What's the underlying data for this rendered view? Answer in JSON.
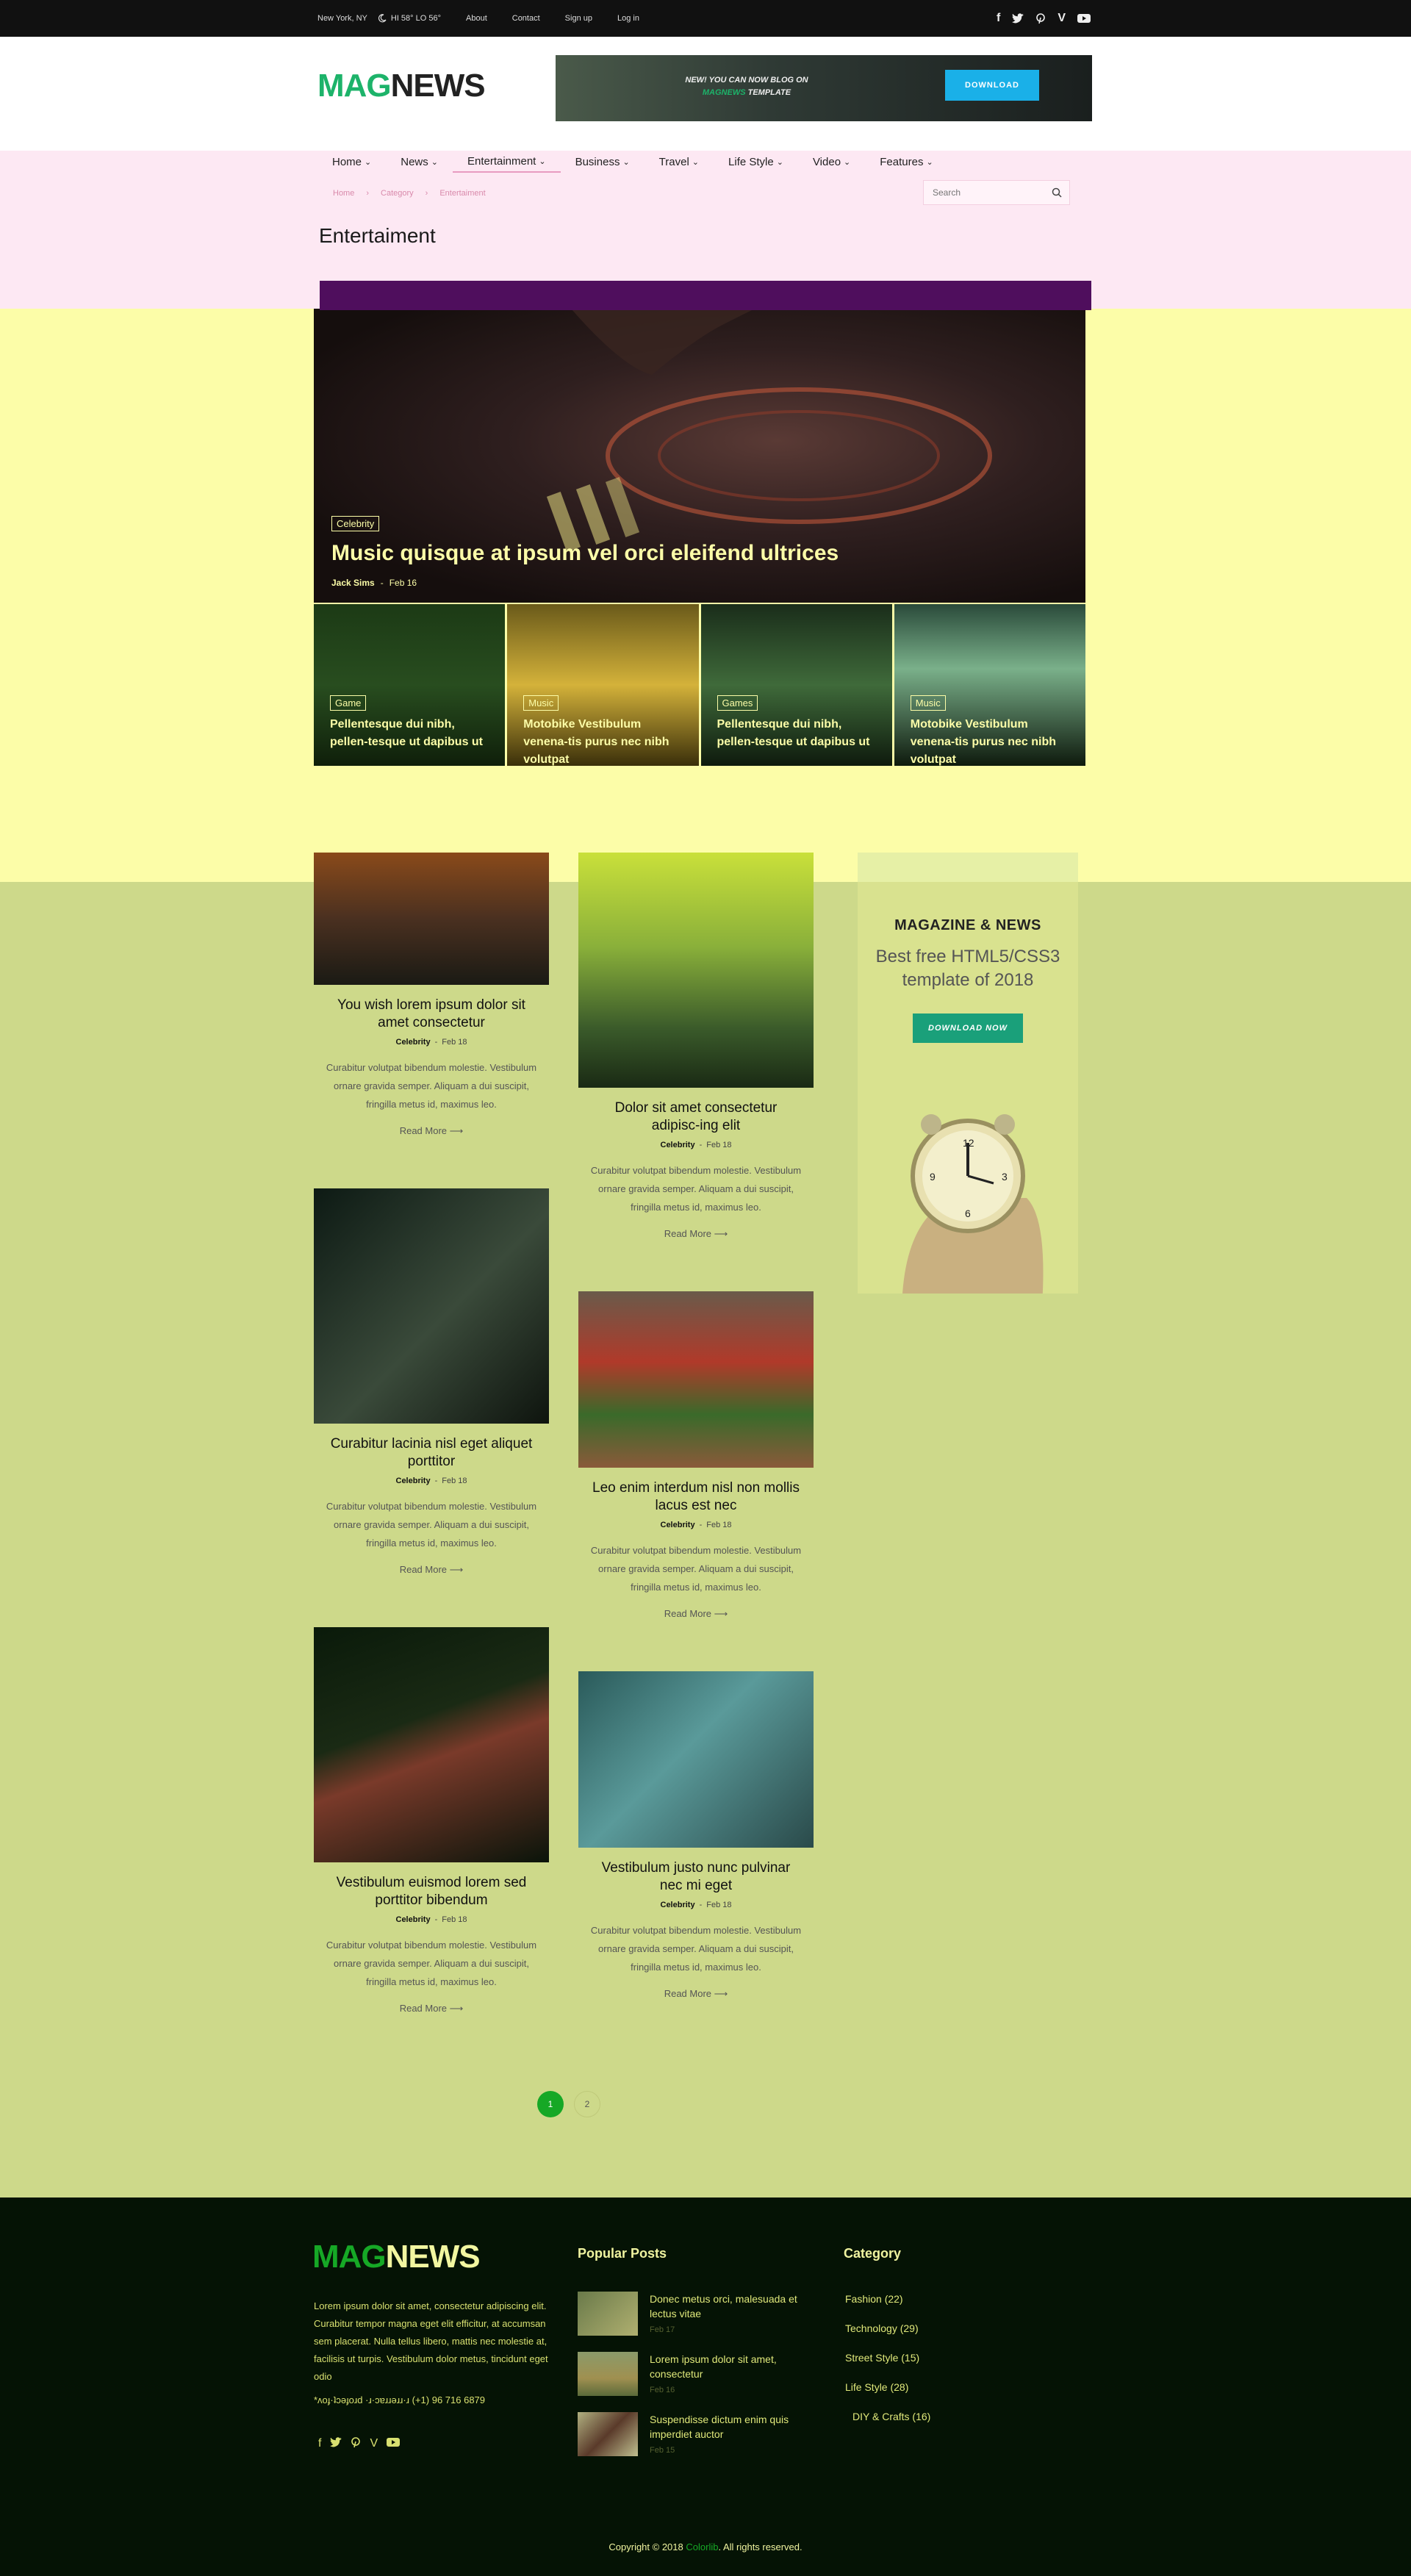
{
  "topbar": {
    "location": "New York, NY",
    "weather": "HI 58° LO 56°",
    "links": [
      "About",
      "Contact",
      "Sign up",
      "Log in"
    ],
    "socials": [
      "facebook-icon",
      "twitter-icon",
      "pinterest-icon",
      "vimeo-icon",
      "youtube-icon"
    ]
  },
  "header": {
    "logo_mag": "MAG",
    "logo_news": "NEWS",
    "banner_line1_strong": "NEW!",
    "banner_line1": "YOU CAN NOW BLOG ON",
    "banner_line2_brand": "MAGNEWS",
    "banner_line2": "TEMPLATE",
    "banner_button": "DOWNLOAD"
  },
  "nav": {
    "items": [
      {
        "label": "Home",
        "dropdown": true
      },
      {
        "label": "News",
        "dropdown": true
      },
      {
        "label": "Entertainment",
        "dropdown": true,
        "active": true
      },
      {
        "label": "Business",
        "dropdown": true
      },
      {
        "label": "Travel",
        "dropdown": true
      },
      {
        "label": "Life Style",
        "dropdown": true
      },
      {
        "label": "Video",
        "dropdown": true
      },
      {
        "label": "Features",
        "dropdown": true
      }
    ]
  },
  "breadcrumb": [
    "Home",
    "Category",
    "Entertaiment"
  ],
  "search": {
    "placeholder": "Search"
  },
  "page_title": "Entertaiment",
  "hero": {
    "tag": "Celebrity",
    "title": "Music quisque at ipsum vel orci eleifend ultrices",
    "author": "Jack Sims",
    "date": "Feb 16"
  },
  "thumbs": [
    {
      "tag": "Game",
      "title": "Pellentesque dui nibh, pellen-tesque ut dapibus ut"
    },
    {
      "tag": "Music",
      "title": "Motobike Vestibulum venena-tis purus nec nibh volutpat"
    },
    {
      "tag": "Games",
      "title": "Pellentesque dui nibh, pellen-tesque ut dapibus ut"
    },
    {
      "tag": "Music",
      "title": "Motobike Vestibulum venena-tis purus nec nibh volutpat"
    }
  ],
  "articles": [
    {
      "title": "You wish lorem ipsum dolor sit amet consectetur",
      "category": "Celebrity",
      "date": "Feb 18",
      "excerpt": "Curabitur volutpat bibendum molestie. Vestibulum ornare gravida semper. Aliquam a dui suscipit, fringilla metus id, maximus leo.",
      "more": "Read More"
    },
    {
      "title": "Dolor sit amet consectetur adipisc-ing elit",
      "category": "Celebrity",
      "date": "Feb 18",
      "excerpt": "Curabitur volutpat bibendum molestie. Vestibulum ornare gravida semper. Aliquam a dui suscipit, fringilla metus id, maximus leo.",
      "more": "Read More"
    },
    {
      "title": "Curabitur lacinia nisl eget aliquet porttitor",
      "category": "Celebrity",
      "date": "Feb 18",
      "excerpt": "Curabitur volutpat bibendum molestie. Vestibulum ornare gravida semper. Aliquam a dui suscipit, fringilla metus id, maximus leo.",
      "more": "Read More"
    },
    {
      "title": "Leo enim interdum nisl non mollis lacus est nec",
      "category": "Celebrity",
      "date": "Feb 18",
      "excerpt": "Curabitur volutpat bibendum molestie. Vestibulum ornare gravida semper. Aliquam a dui suscipit, fringilla metus id, maximus leo.",
      "more": "Read More"
    },
    {
      "title": "Vestibulum euismod lorem sed porttitor bibendum",
      "category": "Celebrity",
      "date": "Feb 18",
      "excerpt": "Curabitur volutpat bibendum molestie. Vestibulum ornare gravida semper. Aliquam a dui suscipit, fringilla metus id, maximus leo.",
      "more": "Read More"
    },
    {
      "title": "Vestibulum justo nunc pulvinar nec mi eget",
      "category": "Celebrity",
      "date": "Feb 18",
      "excerpt": "Curabitur volutpat bibendum molestie. Vestibulum ornare gravida semper. Aliquam a dui suscipit, fringilla metus id, maximus leo.",
      "more": "Read More"
    }
  ],
  "ad": {
    "heading": "MAGAZINE & NEWS",
    "sub": "Best free HTML5/CSS3 template of 2018",
    "button": "DOWNLOAD NOW"
  },
  "pagination": [
    "1",
    "2"
  ],
  "footer": {
    "logo_mag": "MAG",
    "logo_news": "NEWS",
    "about": "Lorem ipsum dolor sit amet, consectetur adipiscing elit. Curabitur tempor magna eget elit efficitur, at accumsan sem placerat. Nulla tellus libero, mattis nec molestie at, facilisis ut turpis. Vestibulum dolor metus, tincidunt eget odio",
    "phone": "*ʌoɟ·ʇɔǝɟoɹd ·ɹ·ɔɐɹɹǝɹɹ·ɹ (+1) 96 716 6879",
    "popular_heading": "Popular Posts",
    "popular": [
      {
        "title": "Donec metus orci, malesuada et lectus vitae",
        "date": "Feb 17"
      },
      {
        "title": "Lorem ipsum dolor sit amet, consectetur",
        "date": "Feb 16"
      },
      {
        "title": "Suspendisse dictum enim quis imperdiet auctor",
        "date": "Feb 15"
      }
    ],
    "category_heading": "Category",
    "categories": [
      "Fashion (22)",
      "Technology (29)",
      "Street Style (15)",
      "Life Style (28)",
      "DIY & Crafts (16)"
    ],
    "copyright_pre": "Copyright © 2018",
    "copyright_brand": "Colorlib",
    "copyright_post": ". All rights reserved."
  },
  "colors": {
    "brand_green": "#1db36a",
    "download_blue": "#1ab0e8",
    "active_page": "#16a826"
  }
}
